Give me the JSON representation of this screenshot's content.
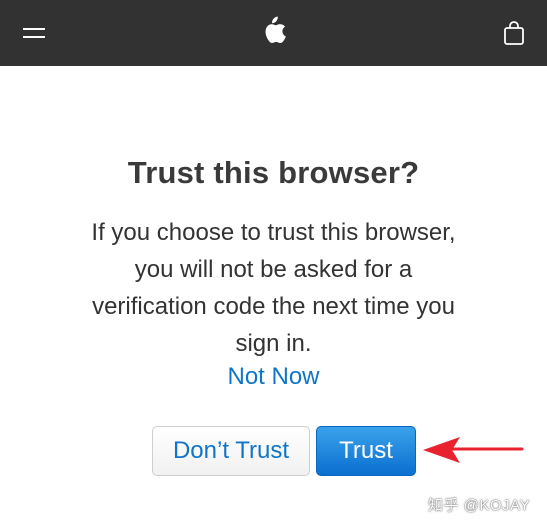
{
  "navbar": {
    "menu_icon": "hamburger-menu-icon",
    "logo_icon": "apple-logo-icon",
    "bag_icon": "shopping-bag-icon"
  },
  "dialog": {
    "title": "Trust this browser?",
    "message_lines": [
      "If you choose to trust this browser,",
      "you will not be asked for a",
      "verification code the next time you",
      "sign in."
    ],
    "not_now_label": "Not Now",
    "dont_trust_label": "Don’t Trust",
    "trust_label": "Trust"
  },
  "annotation": {
    "arrow_icon": "red-pointer-arrow-icon",
    "arrow_color": "#e8232f"
  },
  "watermark": {
    "text": "知乎 @KOJAY"
  },
  "colors": {
    "navbar_bg": "#323232",
    "link_blue": "#0f75c8",
    "primary_button": "#1a82dc"
  }
}
